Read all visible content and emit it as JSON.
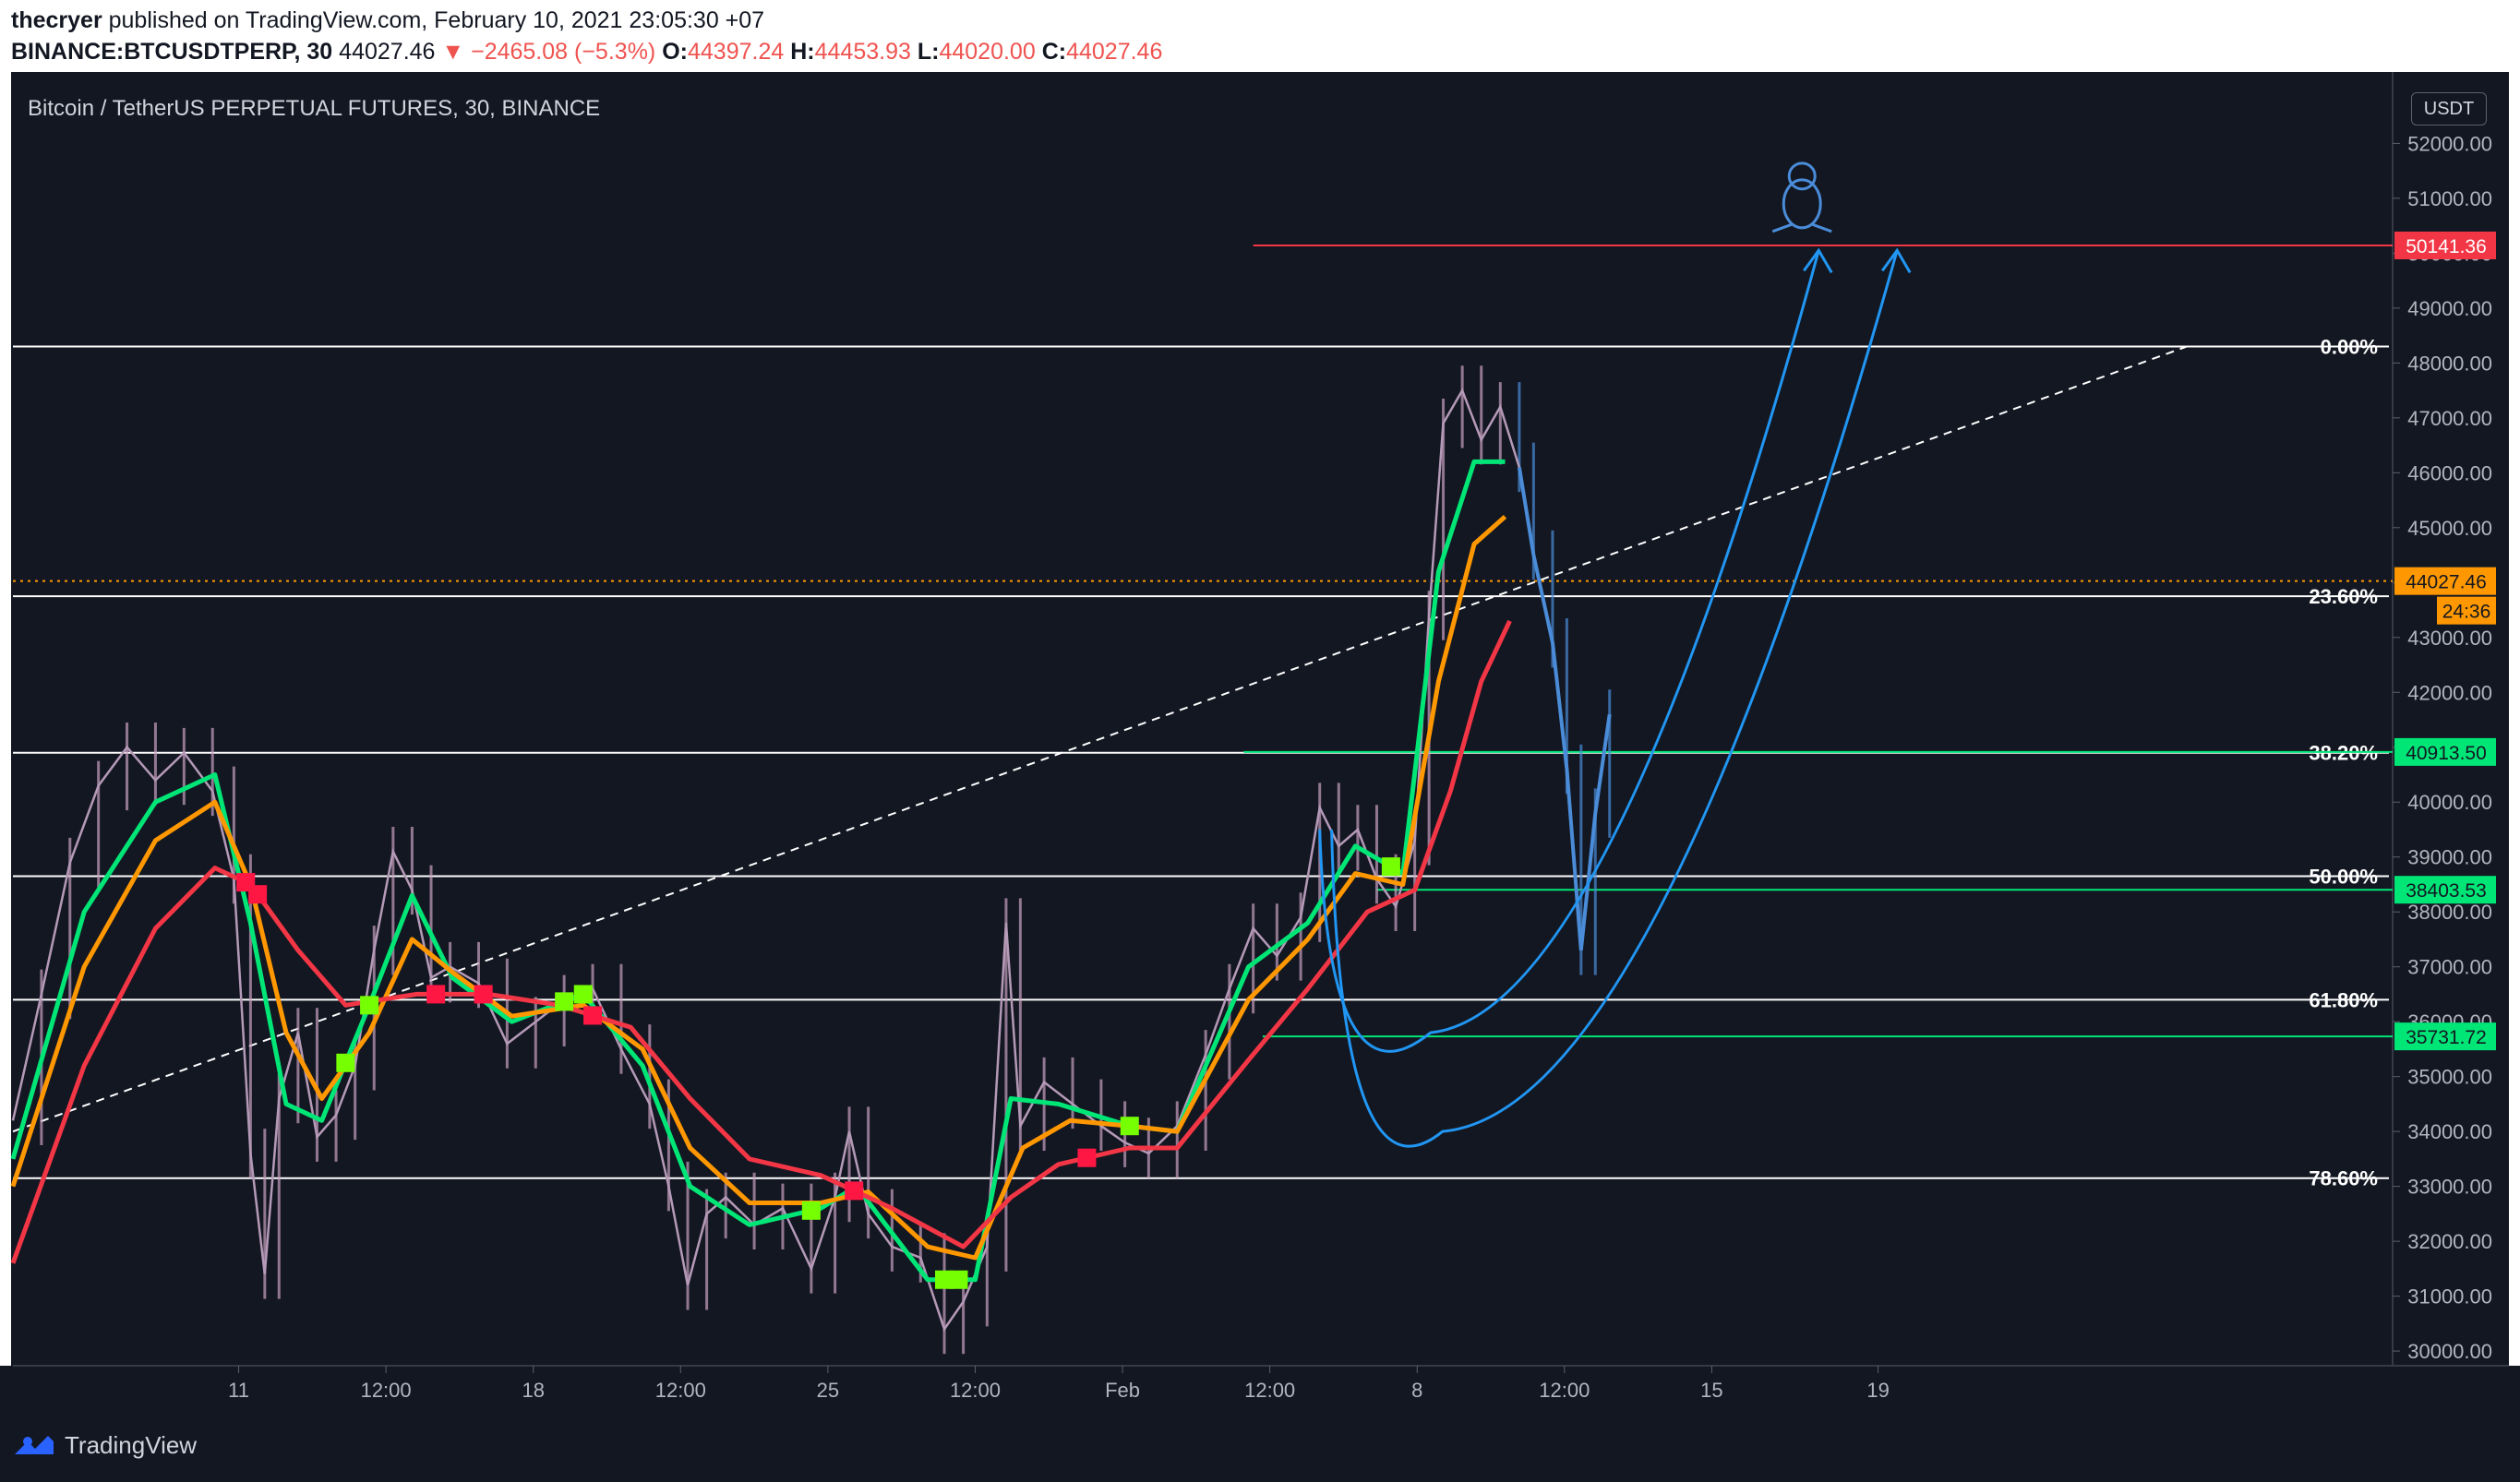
{
  "header": {
    "author": "thecryer",
    "published_text": "published on TradingView.com, February 10, 2021 23:05:30 +07",
    "symbol": "BINANCE:BTCUSDTPERP, 30",
    "last": "44027.46",
    "change": "▼ −2465.08 (−5.3%)",
    "o_label": "O:",
    "o_value": "44397.24",
    "h_label": "H:",
    "h_value": "44453.93",
    "l_label": "L:",
    "l_value": "44020.00",
    "c_label": "C:",
    "c_value": "44027.46"
  },
  "chart_title": "Bitcoin / TetherUS PERPETUAL FUTURES, 30, BINANCE",
  "currency_badge": "USDT",
  "footer": {
    "brand": "TradingView"
  },
  "colors": {
    "background": "#131722",
    "price_up_green": "#00e676",
    "ema_fast": "#4caf50",
    "ema_mid": "#ff9800",
    "ema_slow": "#f23645",
    "fib_lines": "#ffffff",
    "projection_blue": "#2196f3",
    "target_red": "#f23645"
  },
  "chart_data": {
    "type": "line",
    "title": "Bitcoin / TetherUS PERPETUAL FUTURES, 30, BINANCE",
    "ylabel": "USDT",
    "ylim": [
      29800,
      53200
    ],
    "y_ticks": [
      30000,
      31000,
      32000,
      33000,
      34000,
      35000,
      36000,
      37000,
      38000,
      39000,
      40000,
      41000,
      42000,
      43000,
      44000,
      45000,
      46000,
      47000,
      48000,
      49000,
      50000,
      51000,
      52000
    ],
    "y_tick_labels": [
      "30000.00",
      "31000.00",
      "32000.00",
      "33000.00",
      "34000.00",
      "35000.00",
      "36000.00",
      "37000.00",
      "38000.00",
      "39000.00",
      "40000.00",
      "41000.00",
      "42000.00",
      "43000.00",
      "44000.00",
      "45000.00",
      "46000.00",
      "47000.00",
      "48000.00",
      "49000.00",
      "50000.00",
      "51000.00",
      "52000.00"
    ],
    "x_ticks": [
      {
        "label": "11",
        "t": 0.095
      },
      {
        "label": "12:00",
        "t": 0.157
      },
      {
        "label": "18",
        "t": 0.219
      },
      {
        "label": "12:00",
        "t": 0.281
      },
      {
        "label": "25",
        "t": 0.343
      },
      {
        "label": "12:00",
        "t": 0.405
      },
      {
        "label": "Feb",
        "t": 0.467
      },
      {
        "label": "12:00",
        "t": 0.529
      },
      {
        "label": "8",
        "t": 0.591
      },
      {
        "label": "12:00",
        "t": 0.653
      },
      {
        "label": "15",
        "t": 0.715
      },
      {
        "label": "19",
        "t": 0.785
      }
    ],
    "price_series": [
      {
        "t": 0.0,
        "v": 34200
      },
      {
        "t": 0.012,
        "v": 36500
      },
      {
        "t": 0.024,
        "v": 38900
      },
      {
        "t": 0.036,
        "v": 40300
      },
      {
        "t": 0.048,
        "v": 41000
      },
      {
        "t": 0.06,
        "v": 40400
      },
      {
        "t": 0.072,
        "v": 40900
      },
      {
        "t": 0.084,
        "v": 40200
      },
      {
        "t": 0.093,
        "v": 38600
      },
      {
        "t": 0.1,
        "v": 33600
      },
      {
        "t": 0.106,
        "v": 31400
      },
      {
        "t": 0.112,
        "v": 34600
      },
      {
        "t": 0.12,
        "v": 35800
      },
      {
        "t": 0.128,
        "v": 33900
      },
      {
        "t": 0.136,
        "v": 34300
      },
      {
        "t": 0.144,
        "v": 35200
      },
      {
        "t": 0.152,
        "v": 37300
      },
      {
        "t": 0.16,
        "v": 39100
      },
      {
        "t": 0.168,
        "v": 38400
      },
      {
        "t": 0.176,
        "v": 36800
      },
      {
        "t": 0.184,
        "v": 37000
      },
      {
        "t": 0.196,
        "v": 36700
      },
      {
        "t": 0.208,
        "v": 35600
      },
      {
        "t": 0.22,
        "v": 36000
      },
      {
        "t": 0.232,
        "v": 36400
      },
      {
        "t": 0.244,
        "v": 36600
      },
      {
        "t": 0.256,
        "v": 35500
      },
      {
        "t": 0.268,
        "v": 34500
      },
      {
        "t": 0.276,
        "v": 33000
      },
      {
        "t": 0.284,
        "v": 31200
      },
      {
        "t": 0.292,
        "v": 32500
      },
      {
        "t": 0.3,
        "v": 32800
      },
      {
        "t": 0.312,
        "v": 32300
      },
      {
        "t": 0.324,
        "v": 32600
      },
      {
        "t": 0.336,
        "v": 31500
      },
      {
        "t": 0.346,
        "v": 32800
      },
      {
        "t": 0.352,
        "v": 34000
      },
      {
        "t": 0.36,
        "v": 32500
      },
      {
        "t": 0.37,
        "v": 31900
      },
      {
        "t": 0.382,
        "v": 31700
      },
      {
        "t": 0.392,
        "v": 30400
      },
      {
        "t": 0.4,
        "v": 30900
      },
      {
        "t": 0.41,
        "v": 31900
      },
      {
        "t": 0.418,
        "v": 37800
      },
      {
        "t": 0.424,
        "v": 34100
      },
      {
        "t": 0.434,
        "v": 34900
      },
      {
        "t": 0.446,
        "v": 34500
      },
      {
        "t": 0.458,
        "v": 34100
      },
      {
        "t": 0.468,
        "v": 33800
      },
      {
        "t": 0.478,
        "v": 33600
      },
      {
        "t": 0.49,
        "v": 34100
      },
      {
        "t": 0.502,
        "v": 35400
      },
      {
        "t": 0.512,
        "v": 36600
      },
      {
        "t": 0.522,
        "v": 37700
      },
      {
        "t": 0.532,
        "v": 37200
      },
      {
        "t": 0.542,
        "v": 37900
      },
      {
        "t": 0.55,
        "v": 39900
      },
      {
        "t": 0.558,
        "v": 39200
      },
      {
        "t": 0.566,
        "v": 39500
      },
      {
        "t": 0.574,
        "v": 38600
      },
      {
        "t": 0.582,
        "v": 38100
      },
      {
        "t": 0.59,
        "v": 39300
      },
      {
        "t": 0.596,
        "v": 43400
      },
      {
        "t": 0.602,
        "v": 46900
      },
      {
        "t": 0.61,
        "v": 47500
      },
      {
        "t": 0.618,
        "v": 46600
      },
      {
        "t": 0.626,
        "v": 47200
      },
      {
        "t": 0.634,
        "v": 46100
      },
      {
        "t": 0.64,
        "v": 44500
      },
      {
        "t": 0.648,
        "v": 42900
      },
      {
        "t": 0.654,
        "v": 40600
      },
      {
        "t": 0.66,
        "v": 37300
      },
      {
        "t": 0.666,
        "v": 39800
      },
      {
        "t": 0.672,
        "v": 41600
      }
    ],
    "series": [
      {
        "name": "",
        "color": "#00e676",
        "values": [
          {
            "t": 0.0,
            "v": 33500
          },
          {
            "t": 0.03,
            "v": 38000
          },
          {
            "t": 0.06,
            "v": 40000
          },
          {
            "t": 0.085,
            "v": 40500
          },
          {
            "t": 0.1,
            "v": 37800
          },
          {
            "t": 0.115,
            "v": 34500
          },
          {
            "t": 0.13,
            "v": 34200
          },
          {
            "t": 0.15,
            "v": 36300
          },
          {
            "t": 0.168,
            "v": 38300
          },
          {
            "t": 0.185,
            "v": 36800
          },
          {
            "t": 0.21,
            "v": 36000
          },
          {
            "t": 0.24,
            "v": 36500
          },
          {
            "t": 0.265,
            "v": 35200
          },
          {
            "t": 0.285,
            "v": 33000
          },
          {
            "t": 0.31,
            "v": 32300
          },
          {
            "t": 0.34,
            "v": 32600
          },
          {
            "t": 0.355,
            "v": 33000
          },
          {
            "t": 0.385,
            "v": 31300
          },
          {
            "t": 0.405,
            "v": 31300
          },
          {
            "t": 0.42,
            "v": 34600
          },
          {
            "t": 0.44,
            "v": 34500
          },
          {
            "t": 0.47,
            "v": 34100
          },
          {
            "t": 0.49,
            "v": 34000
          },
          {
            "t": 0.52,
            "v": 37000
          },
          {
            "t": 0.545,
            "v": 37800
          },
          {
            "t": 0.565,
            "v": 39200
          },
          {
            "t": 0.585,
            "v": 38700
          },
          {
            "t": 0.6,
            "v": 44200
          },
          {
            "t": 0.615,
            "v": 46200
          },
          {
            "t": 0.628,
            "v": 46200
          }
        ]
      },
      {
        "name": "",
        "color": "#ff9800",
        "values": [
          {
            "t": 0.0,
            "v": 33000
          },
          {
            "t": 0.03,
            "v": 37000
          },
          {
            "t": 0.06,
            "v": 39300
          },
          {
            "t": 0.085,
            "v": 40000
          },
          {
            "t": 0.1,
            "v": 38500
          },
          {
            "t": 0.115,
            "v": 35800
          },
          {
            "t": 0.13,
            "v": 34600
          },
          {
            "t": 0.15,
            "v": 35800
          },
          {
            "t": 0.168,
            "v": 37500
          },
          {
            "t": 0.185,
            "v": 36900
          },
          {
            "t": 0.21,
            "v": 36100
          },
          {
            "t": 0.24,
            "v": 36300
          },
          {
            "t": 0.265,
            "v": 35500
          },
          {
            "t": 0.285,
            "v": 33700
          },
          {
            "t": 0.31,
            "v": 32700
          },
          {
            "t": 0.34,
            "v": 32700
          },
          {
            "t": 0.36,
            "v": 32900
          },
          {
            "t": 0.385,
            "v": 31900
          },
          {
            "t": 0.405,
            "v": 31700
          },
          {
            "t": 0.425,
            "v": 33700
          },
          {
            "t": 0.445,
            "v": 34200
          },
          {
            "t": 0.47,
            "v": 34100
          },
          {
            "t": 0.49,
            "v": 34000
          },
          {
            "t": 0.52,
            "v": 36400
          },
          {
            "t": 0.545,
            "v": 37500
          },
          {
            "t": 0.565,
            "v": 38700
          },
          {
            "t": 0.585,
            "v": 38500
          },
          {
            "t": 0.6,
            "v": 42200
          },
          {
            "t": 0.615,
            "v": 44700
          },
          {
            "t": 0.628,
            "v": 45200
          }
        ]
      },
      {
        "name": "",
        "color": "#f23645",
        "values": [
          {
            "t": 0.0,
            "v": 31600
          },
          {
            "t": 0.03,
            "v": 35200
          },
          {
            "t": 0.06,
            "v": 37700
          },
          {
            "t": 0.085,
            "v": 38800
          },
          {
            "t": 0.1,
            "v": 38500
          },
          {
            "t": 0.12,
            "v": 37300
          },
          {
            "t": 0.14,
            "v": 36300
          },
          {
            "t": 0.17,
            "v": 36500
          },
          {
            "t": 0.2,
            "v": 36500
          },
          {
            "t": 0.23,
            "v": 36300
          },
          {
            "t": 0.26,
            "v": 35900
          },
          {
            "t": 0.285,
            "v": 34600
          },
          {
            "t": 0.31,
            "v": 33500
          },
          {
            "t": 0.34,
            "v": 33200
          },
          {
            "t": 0.37,
            "v": 32600
          },
          {
            "t": 0.4,
            "v": 31900
          },
          {
            "t": 0.42,
            "v": 32800
          },
          {
            "t": 0.44,
            "v": 33400
          },
          {
            "t": 0.47,
            "v": 33700
          },
          {
            "t": 0.49,
            "v": 33700
          },
          {
            "t": 0.52,
            "v": 35300
          },
          {
            "t": 0.545,
            "v": 36600
          },
          {
            "t": 0.57,
            "v": 38000
          },
          {
            "t": 0.59,
            "v": 38400
          },
          {
            "t": 0.605,
            "v": 40200
          },
          {
            "t": 0.618,
            "v": 42200
          },
          {
            "t": 0.63,
            "v": 43300
          }
        ]
      }
    ],
    "fib_levels": [
      {
        "label": "0.00%",
        "value": 48300
      },
      {
        "label": "23.60%",
        "value": 43750
      },
      {
        "label": "38.20%",
        "value": 40900
      },
      {
        "label": "50.00%",
        "value": 38650
      },
      {
        "label": "61.80%",
        "value": 36400
      },
      {
        "label": "78.60%",
        "value": 33150
      }
    ],
    "horizontal_levels": [
      {
        "label": "50141.36",
        "value": 50141.36,
        "color": "#f23645",
        "t_start": 0.522
      },
      {
        "label": "40913.50",
        "value": 40913.5,
        "color": "#00e676",
        "t_start": 0.518
      },
      {
        "label": "38403.53",
        "value": 38403.53,
        "color": "#00e676",
        "t_start": 0.574
      },
      {
        "label": "35731.72",
        "value": 35731.72,
        "color": "#00e676",
        "t_start": 0.526
      }
    ],
    "current_price": {
      "label": "44027.46",
      "value": 44027.46,
      "countdown": "24:36",
      "color": "#ff9800"
    },
    "trendline": {
      "t1": 0.0,
      "v1": 34000,
      "t2": 0.915,
      "v2": 48300
    },
    "projection_arrows": [
      {
        "t_top": 0.76,
        "v_top": 50050,
        "t_bottom": 0.585,
        "v_bottom": 35800
      },
      {
        "t_top": 0.793,
        "v_top": 50050,
        "t_bottom": 0.59,
        "v_bottom": 34000
      }
    ],
    "grid": false,
    "legend": "none"
  }
}
